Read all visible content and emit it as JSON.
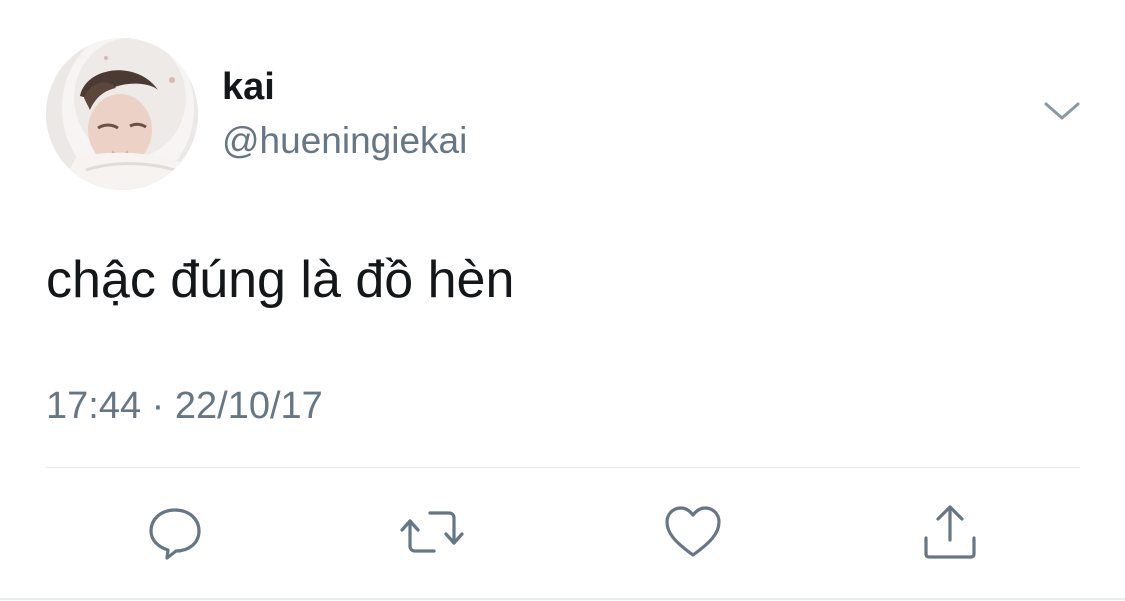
{
  "tweet": {
    "display_name": "kai",
    "handle": "@hueningiekai",
    "text": "chậc đúng là đồ hèn",
    "time": "17:44",
    "separator": "·",
    "date": "22/10/17"
  },
  "icons": {
    "avatar": "profile-photo",
    "menu": "chevron-down-icon",
    "reply": "speech-bubble-icon",
    "retweet": "retweet-arrows-icon",
    "like": "heart-icon",
    "share": "share-upload-icon"
  },
  "colors": {
    "text_primary": "#14171a",
    "text_secondary": "#657786",
    "icon": "#657786",
    "divider": "#e1e8ed"
  }
}
